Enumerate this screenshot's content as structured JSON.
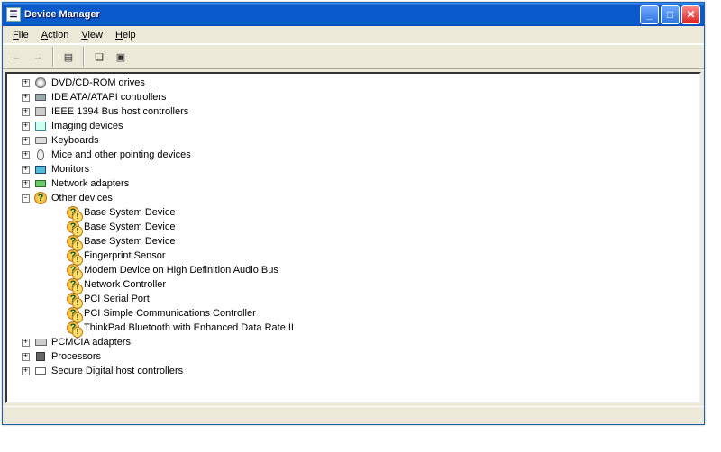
{
  "window": {
    "title": "Device Manager"
  },
  "menu": {
    "file": "File",
    "action": "Action",
    "view": "View",
    "help": "Help"
  },
  "tree": {
    "top": [
      {
        "label": "DVD/CD-ROM drives",
        "icon": "dvd"
      },
      {
        "label": "IDE ATA/ATAPI controllers",
        "icon": "ide"
      },
      {
        "label": "IEEE 1394 Bus host controllers",
        "icon": "1394"
      },
      {
        "label": "Imaging devices",
        "icon": "img"
      },
      {
        "label": "Keyboards",
        "icon": "kbd"
      },
      {
        "label": "Mice and other pointing devices",
        "icon": "mouse"
      },
      {
        "label": "Monitors",
        "icon": "mon"
      },
      {
        "label": "Network adapters",
        "icon": "net"
      }
    ],
    "other": {
      "label": "Other devices",
      "children": [
        "Base System Device",
        "Base System Device",
        "Base System Device",
        "Fingerprint Sensor",
        "Modem Device on High Definition Audio Bus",
        "Network Controller",
        "PCI Serial Port",
        "PCI Simple Communications Controller",
        "ThinkPad Bluetooth with Enhanced Data Rate II"
      ]
    },
    "bottom": [
      {
        "label": "PCMCIA adapters",
        "icon": "pcmcia"
      },
      {
        "label": "Processors",
        "icon": "proc"
      },
      {
        "label": "Secure Digital host controllers",
        "icon": "sd"
      }
    ]
  }
}
